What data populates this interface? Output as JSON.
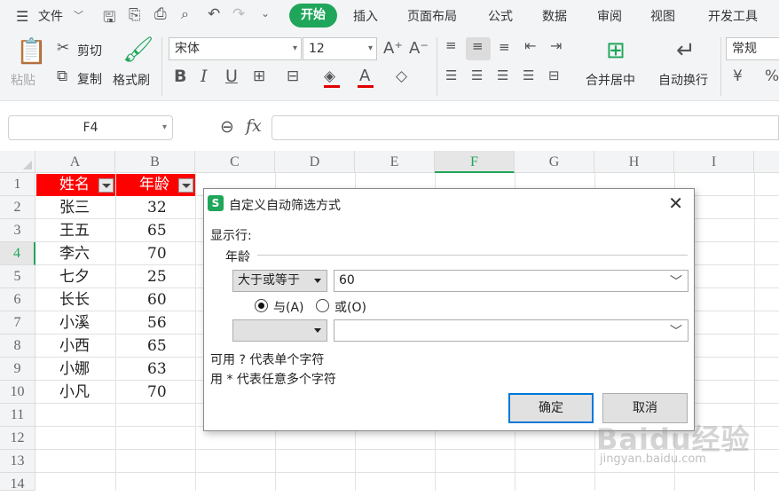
{
  "menu": {
    "file": "文件",
    "tabs": [
      "开始",
      "插入",
      "页面布局",
      "公式",
      "数据",
      "审阅",
      "视图",
      "开发工具"
    ],
    "active_tab": "开始",
    "accent_color": "#1fa65a"
  },
  "ribbon": {
    "paste": "粘贴",
    "cut": "剪切",
    "copy": "复制",
    "format_painter": "格式刷",
    "font_name": "宋体",
    "font_size": "12",
    "merge_center": "合并居中",
    "wrap_text": "自动换行",
    "number_format": "常规"
  },
  "formula_bar": {
    "cell_ref": "F4",
    "fx": "fx",
    "value": ""
  },
  "sheet": {
    "columns": [
      "A",
      "B",
      "C",
      "D",
      "E",
      "F",
      "G",
      "H",
      "I"
    ],
    "rows": [
      "1",
      "2",
      "3",
      "4",
      "5",
      "6",
      "7",
      "8",
      "9",
      "10",
      "11",
      "12",
      "13",
      "14"
    ],
    "header": [
      "姓名",
      "年龄"
    ],
    "data": [
      [
        "张三",
        "32"
      ],
      [
        "王五",
        "65"
      ],
      [
        "李六",
        "70"
      ],
      [
        "七夕",
        "25"
      ],
      [
        "长长",
        "60"
      ],
      [
        "小溪",
        "56"
      ],
      [
        "小西",
        "65"
      ],
      [
        "小娜",
        "63"
      ],
      [
        "小凡",
        "70"
      ]
    ],
    "header_fill": "#ff0000",
    "selected_cell": "F4"
  },
  "dialog": {
    "title": "自定义自动筛选方式",
    "show_rows": "显示行:",
    "field": "年龄",
    "condition1_operator": "大于或等于",
    "condition1_value": "60",
    "and_label": "与(A)",
    "or_label": "或(O)",
    "and_selected": true,
    "condition2_operator": "",
    "condition2_value": "",
    "hint1": "可用 ? 代表单个字符",
    "hint2": "用 * 代表任意多个字符",
    "ok": "确定",
    "cancel": "取消",
    "close": "✕"
  },
  "watermark": {
    "brand": "Baidu经验",
    "url": "jingyan.baidu.com"
  }
}
